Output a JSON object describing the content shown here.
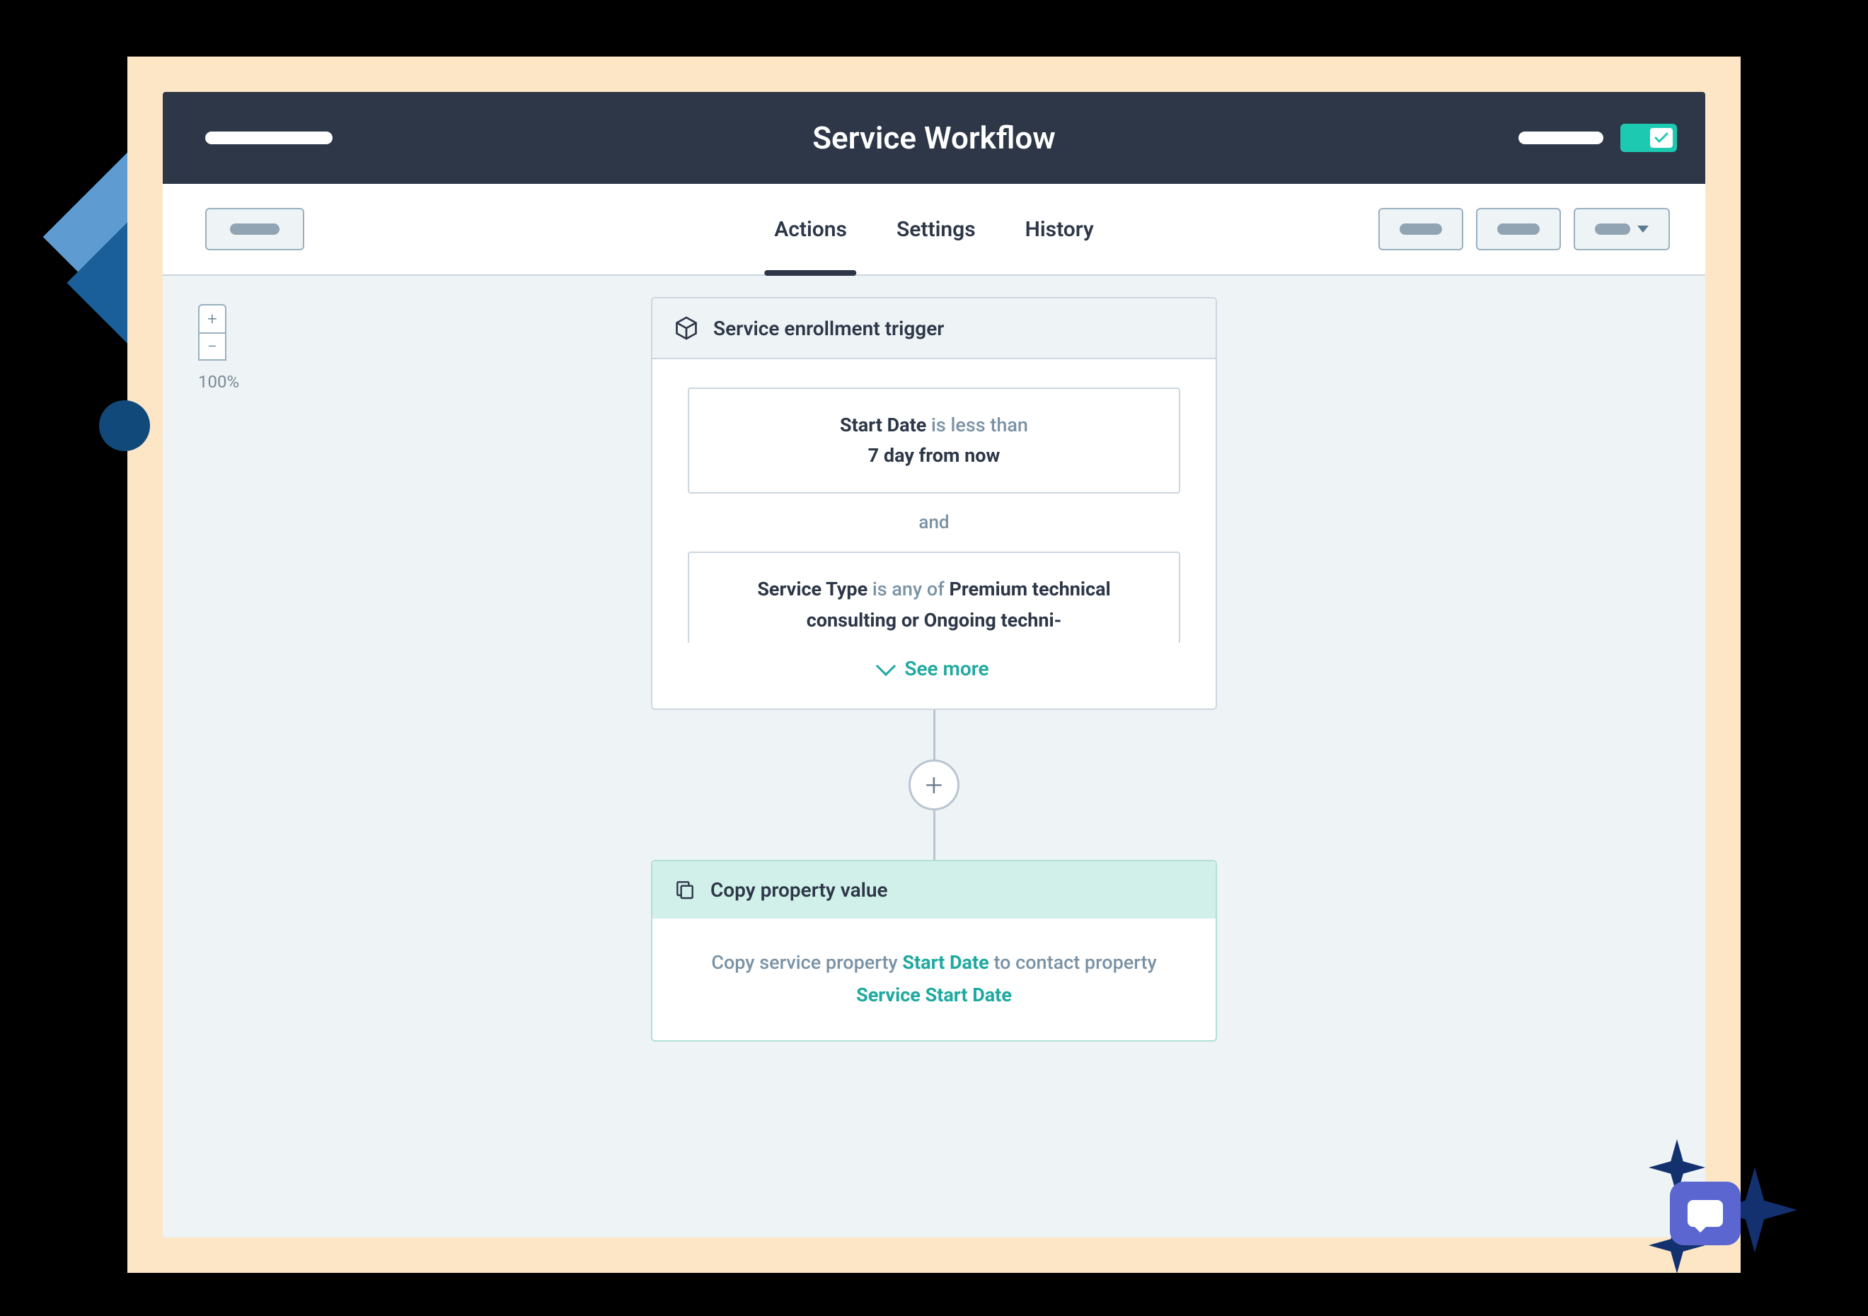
{
  "header": {
    "title": "Service Workflow",
    "toggle_on": true
  },
  "tabs": {
    "actions": "Actions",
    "settings": "Settings",
    "history": "History",
    "active": "actions"
  },
  "zoom": {
    "level": "100%"
  },
  "trigger": {
    "title": "Service enrollment trigger",
    "condition1": {
      "property": "Start Date",
      "operator": "is less than",
      "value": "7 day from now"
    },
    "separator": "and",
    "condition2": {
      "property": "Service Type",
      "operator": "is any of",
      "value": "Premium technical consulting or Ongoing techni-"
    },
    "see_more": "See more"
  },
  "action": {
    "title": "Copy property value",
    "body_prefix": "Copy service property",
    "link1": "Start Date",
    "body_mid": "to contact property",
    "link2": "Service Start Date"
  }
}
